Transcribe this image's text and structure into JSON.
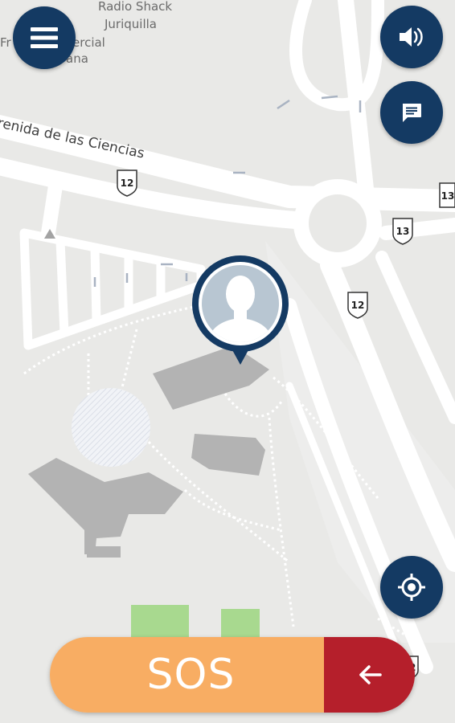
{
  "map": {
    "place_labels": [
      "Radio Shack",
      "Juriquilla",
      "Fr",
      "ercial",
      "ana"
    ],
    "street_label": "renida de las Ciencias",
    "route_shields": [
      "12",
      "13",
      "13",
      "12",
      "12"
    ]
  },
  "controls": {
    "menu_icon": "hamburger-menu-icon",
    "sound_icon": "speaker-icon",
    "chat_icon": "chat-bubble-icon",
    "locate_icon": "crosshair-locate-icon"
  },
  "user_marker": {
    "icon": "user-avatar-icon"
  },
  "sos": {
    "label": "SOS",
    "back_icon": "arrow-left-icon",
    "colors": {
      "sos": "#f8ad63",
      "back": "#b51f2b",
      "buttons": "#143a63"
    }
  }
}
